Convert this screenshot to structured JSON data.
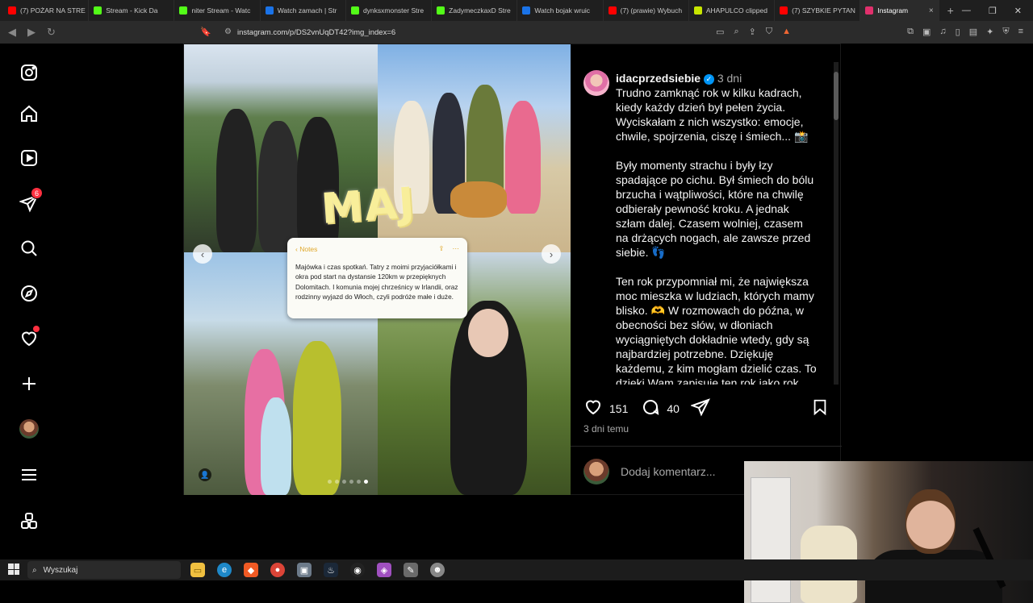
{
  "browser": {
    "tabs": [
      {
        "label": "(7) POŻAR NA STRE",
        "color": "#ff0000"
      },
      {
        "label": "Stream - Kick Da",
        "color": "#53fc18"
      },
      {
        "label": "niter Stream - Watc",
        "color": "#53fc18"
      },
      {
        "label": "Watch zamach | Str",
        "color": "#1a73e8"
      },
      {
        "label": "dynksxmonster Stre",
        "color": "#53fc18"
      },
      {
        "label": "ZadymeczkaxD Stre",
        "color": "#53fc18"
      },
      {
        "label": "Watch bojak wruic",
        "color": "#1a73e8"
      },
      {
        "label": "(7) (prawie) Wybuch",
        "color": "#ff0000"
      },
      {
        "label": "AHAPULCO clipped",
        "color": "#c8e600"
      },
      {
        "label": "(7) SZYBKIE PYTAN",
        "color": "#ff0000"
      }
    ],
    "active_tab": {
      "label": "Instagram",
      "color": "#e1306c"
    },
    "url": "instagram.com/p/DS2vnUqDT42?img_index=6"
  },
  "sidebar": {
    "messages_badge": "6"
  },
  "post": {
    "overlay_title": "MAJ",
    "notes": {
      "header": "Notes",
      "body": "Majówka i czas spotkań. Tatry z moimi przyjaciółkami i okra pod start na dystansie 120km w przepięknych Dolomitach. I komunia mojej chrześnicy w Irlandii, oraz rodzinny wyjazd do Włoch, czyli podróże małe i duże."
    },
    "carousel_dots": 6,
    "active_dot": 5
  },
  "caption": {
    "username": "idacprzedsiebie",
    "time": "3 dni",
    "p1": "Trudno zamknąć rok w kilku kadrach, kiedy każdy dzień był pełen życia. Wyciskałam z nich wszystko: emocje, chwile, spojrzenia, ciszę i śmiech... 📸",
    "p2": "Były momenty strachu i były łzy spadające po cichu. Był śmiech do bólu brzucha i wątpliwości, które na chwilę odbierały pewność kroku. A jednak szłam dalej. Czasem wolniej, czasem na drżących nogach, ale zawsze przed siebie. 👣",
    "p3": "Ten rok przypomniał mi, że największa moc mieszka w ludziach, których mamy blisko. 🫶 W rozmowach do późna, w obecności bez słów, w dłoniach wyciągniętych dokładnie wtedy, gdy są najbardziej potrzebne. Dziękuję każdemu, z kim mogłam dzielić czas. To dzięki Wam zapisuje ten rok jako rok"
  },
  "actions": {
    "likes": "151",
    "comments": "40",
    "ago": "3 dni temu",
    "comment_placeholder": "Dodaj komentarz..."
  },
  "taskbar": {
    "search_placeholder": "Wyszukaj"
  }
}
